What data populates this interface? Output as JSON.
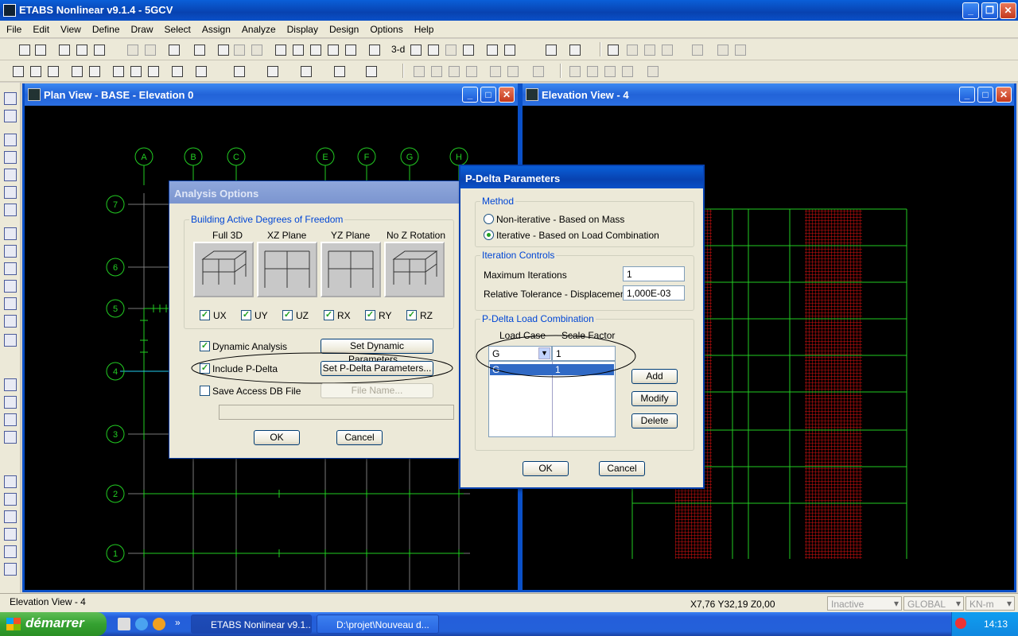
{
  "app": {
    "title": "ETABS Nonlinear v9.1.4 - 5GCV"
  },
  "menu": [
    "File",
    "Edit",
    "View",
    "Define",
    "Draw",
    "Select",
    "Assign",
    "Analyze",
    "Display",
    "Design",
    "Options",
    "Help"
  ],
  "toolbar": {
    "label_3d": "3-d"
  },
  "plan_view": {
    "title": "Plan View - BASE - Elevation 0",
    "grid_columns": [
      "A",
      "B",
      "C",
      "E",
      "F",
      "G",
      "H"
    ],
    "grid_rows": [
      "7",
      "6",
      "5",
      "4",
      "3",
      "2",
      "1"
    ]
  },
  "elevation_view": {
    "title": "Elevation View - 4"
  },
  "analysis_options": {
    "title": "Analysis Options",
    "group_dof": "Building Active Degrees of Freedom",
    "presets": [
      "Full 3D",
      "XZ Plane",
      "YZ Plane",
      "No Z Rotation"
    ],
    "dofs": [
      "UX",
      "UY",
      "UZ",
      "RX",
      "RY",
      "RZ"
    ],
    "dynamic_analysis": "Dynamic Analysis",
    "set_dynamic": "Set Dynamic Parameters...",
    "include_pdelta": "Include P-Delta",
    "set_pdelta": "Set P-Delta Parameters...",
    "save_access": "Save Access DB File",
    "file_name": "File Name...",
    "ok": "OK",
    "cancel": "Cancel"
  },
  "pdelta": {
    "title": "P-Delta Parameters",
    "method_label": "Method",
    "method_options": [
      "Non-iterative - Based on Mass",
      "Iterative - Based on Load Combination"
    ],
    "iteration_label": "Iteration Controls",
    "max_iter_label": "Maximum Iterations",
    "max_iter_value": "1",
    "rel_tol_label": "Relative Tolerance - Displacements",
    "rel_tol_value": "1,000E-03",
    "combo_label": "P-Delta Load Combination",
    "col_load_case": "Load Case",
    "col_scale": "Scale Factor",
    "input_case": "G",
    "input_scale": "1",
    "rows": [
      {
        "case": "G",
        "scale": "1"
      }
    ],
    "add": "Add",
    "modify": "Modify",
    "delete": "Delete",
    "ok": "OK",
    "cancel": "Cancel"
  },
  "status": {
    "left": "Elevation View - 4",
    "coords": "X7,76  Y32,19  Z0,00",
    "mode": "Inactive",
    "system": "GLOBAL",
    "units": "KN-m"
  },
  "taskbar": {
    "start": "démarrer",
    "tasks": [
      "ETABS Nonlinear v9.1...",
      "D:\\projet\\Nouveau d..."
    ],
    "time": "14:13"
  }
}
